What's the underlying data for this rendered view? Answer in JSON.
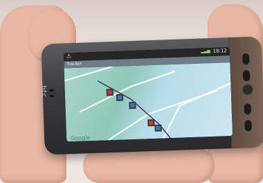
{
  "status_bar": {
    "time": "18:12",
    "warning_icon": "warning-icon",
    "signal_icon": "signal-icon"
  },
  "app_bar": {
    "title": "Tracker"
  },
  "phone": {
    "brand": "htc"
  },
  "map": {
    "places": [
      {
        "label": "Google",
        "type": "watermark"
      }
    ],
    "markers": [
      {
        "icon": "location-marker-icon"
      },
      {
        "icon": "location-marker-icon"
      },
      {
        "icon": "location-marker-icon"
      },
      {
        "icon": "location-marker-icon"
      },
      {
        "icon": "location-marker-icon"
      }
    ]
  }
}
